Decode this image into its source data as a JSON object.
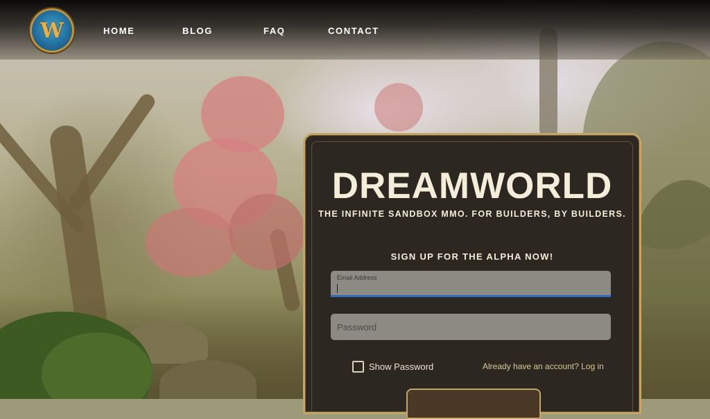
{
  "brand": {
    "logo_icon": "dreamworld-logo-icon",
    "logo_letter": "W"
  },
  "nav": {
    "items": [
      {
        "label": "HOME"
      },
      {
        "label": "BLOG"
      },
      {
        "label": "FAQ"
      },
      {
        "label": "CONTACT"
      }
    ]
  },
  "hero": {
    "title": "DREAMWORLD",
    "tagline": "THE INFINITE SANDBOX MMO. FOR BUILDERS, BY BUILDERS."
  },
  "signup": {
    "heading": "SIGN UP FOR THE ALPHA NOW!",
    "email": {
      "label": "Email Address",
      "value": ""
    },
    "password": {
      "placeholder": "Password",
      "value": ""
    },
    "show_password": {
      "label": "Show Password",
      "checked": false
    },
    "login_link": "Already have an account? Log in"
  },
  "colors": {
    "panel_bg": "#2c2721",
    "panel_border": "#c2a567",
    "text_light": "#f3edd9",
    "input_bg": "#8c8a82",
    "focus_underline": "#2f6ec0",
    "link": "#d9c896"
  }
}
